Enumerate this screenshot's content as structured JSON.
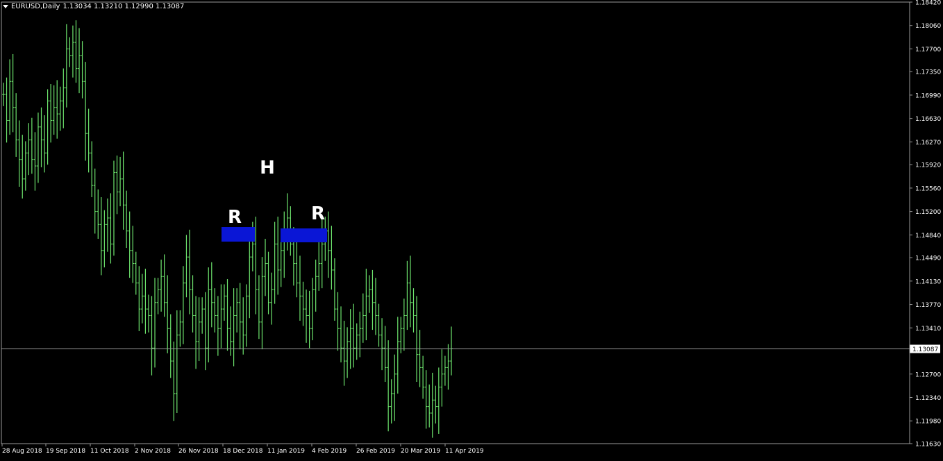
{
  "header": {
    "symbol": "EURUSD,Daily",
    "ohlc": "1.13034 1.13210 1.12990 1.13087"
  },
  "current_price_label": "1.13087",
  "annotations": {
    "left": "R",
    "head": "H",
    "right": "R"
  },
  "colors": {
    "background": "#000000",
    "candles": "#6ee66e",
    "grid_line": "#9a9a9a",
    "zone": "#0a16d6",
    "text": "#ffffff"
  },
  "chart_data": {
    "type": "line",
    "title": "",
    "ylim": [
      1.1163,
      1.1842
    ],
    "y_ticks": [
      "1.18420",
      "1.18060",
      "1.17700",
      "1.17350",
      "1.16990",
      "1.16630",
      "1.16270",
      "1.15920",
      "1.15560",
      "1.15200",
      "1.14840",
      "1.14490",
      "1.14130",
      "1.13770",
      "1.13410",
      "1.13087",
      "1.12700",
      "1.12340",
      "1.11980",
      "1.11630"
    ],
    "x_ticks": [
      "28 Aug 2018",
      "19 Sep 2018",
      "11 Oct 2018",
      "2 Nov 2018",
      "26 Nov 2018",
      "18 Dec 2018",
      "11 Jan 2019",
      "4 Feb 2019",
      "26 Feb 2019",
      "20 Mar 2019",
      "11 Apr 2019"
    ],
    "series": [
      {
        "values": [
          1.17,
          1.166,
          1.172,
          1.168,
          1.163,
          1.16,
          1.157,
          1.161,
          1.163,
          1.16,
          1.159,
          1.165,
          1.163,
          1.161,
          1.169,
          1.166,
          1.168,
          1.167,
          1.169,
          1.171,
          1.177,
          1.176,
          1.178,
          1.174,
          1.176,
          1.172,
          1.164,
          1.161,
          1.156,
          1.152,
          1.15,
          1.146,
          1.15,
          1.151,
          1.147,
          1.158,
          1.155,
          1.157,
          1.153,
          1.149,
          1.146,
          1.144,
          1.141,
          1.137,
          1.139,
          1.137,
          1.136,
          1.131,
          1.138,
          1.14,
          1.142,
          1.138,
          1.134,
          1.129,
          1.124,
          1.133,
          1.135,
          1.141,
          1.145,
          1.14,
          1.136,
          1.132,
          1.135,
          1.137,
          1.131,
          1.14,
          1.138,
          1.136,
          1.134,
          1.137,
          1.139,
          1.134,
          1.132,
          1.136,
          1.138,
          1.135,
          1.133,
          1.139,
          1.145,
          1.147,
          1.14,
          1.135,
          1.142,
          1.144,
          1.138,
          1.14,
          1.147,
          1.143,
          1.146,
          1.149,
          1.151,
          1.147,
          1.144,
          1.141,
          1.139,
          1.137,
          1.136,
          1.134,
          1.14,
          1.142,
          1.144,
          1.147,
          1.149,
          1.146,
          1.143,
          1.137,
          1.134,
          1.131,
          1.129,
          1.132,
          1.134,
          1.131,
          1.133,
          1.134,
          1.136,
          1.139,
          1.14,
          1.138,
          1.136,
          1.133,
          1.131,
          1.128,
          1.122,
          1.124,
          1.127,
          1.132,
          1.134,
          1.136,
          1.141,
          1.138,
          1.136,
          1.13,
          1.128,
          1.125,
          1.122,
          1.121,
          1.123,
          1.122,
          1.125,
          1.127,
          1.128,
          1.129,
          1.1309
        ]
      }
    ]
  }
}
